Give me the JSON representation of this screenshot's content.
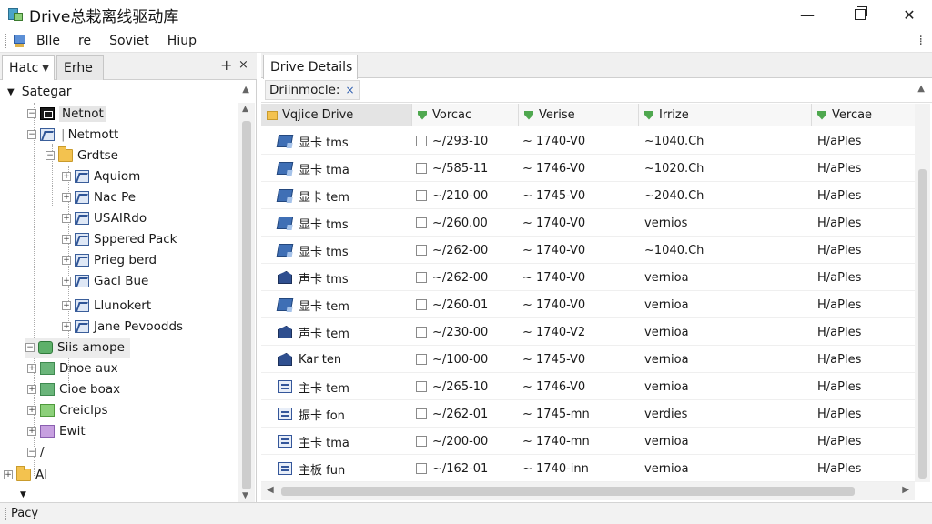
{
  "window": {
    "title": "Drive总栽离线驱动库",
    "min_glyph": "—",
    "close_glyph": "✕"
  },
  "menu": {
    "items": [
      "Blle",
      "re",
      "Soviet",
      "Hiup"
    ],
    "right_glyph": "⁞"
  },
  "left_panel": {
    "tabs": [
      {
        "label": "Hatc",
        "active": true
      },
      {
        "label": "Erhe",
        "active": false
      }
    ],
    "add_glyph": "+",
    "close_glyph": "×",
    "header": "Sategar",
    "tree": [
      {
        "label": "Netnot",
        "icon": "network-drive-icon",
        "highlight": true
      },
      {
        "label": "Netmott",
        "icon": "drive-icon",
        "highlight": false
      },
      {
        "label": "Grdtse",
        "icon": "folder-icon",
        "highlight": false
      },
      {
        "label": "Aquiom",
        "icon": "drive-icon",
        "highlight": false
      },
      {
        "label": "Nac Pe",
        "icon": "drive-icon",
        "highlight": false
      },
      {
        "label": "USAIRdo",
        "icon": "drive-icon",
        "highlight": false
      },
      {
        "label": "Sppered Pack",
        "icon": "drive-icon",
        "highlight": false
      },
      {
        "label": "Prieg berd",
        "icon": "drive-icon",
        "highlight": false
      },
      {
        "label": "Gacl Bue",
        "icon": "drive-icon",
        "highlight": false
      },
      {
        "label": "Llunokert",
        "icon": "drive-icon",
        "highlight": false
      },
      {
        "label": "Jane Pevoodds",
        "icon": "drive-icon",
        "highlight": false
      },
      {
        "label": "Siis amope",
        "icon": "globe-icon",
        "highlight": true
      },
      {
        "label": "Dnoe aux",
        "icon": "green-folder-icon",
        "highlight": false
      },
      {
        "label": "Cioe boax",
        "icon": "green-folder-icon",
        "highlight": false
      },
      {
        "label": "Creiclps",
        "icon": "lime-folder-icon",
        "highlight": false
      },
      {
        "label": "Ewit",
        "icon": "purple-folder-icon",
        "highlight": false
      },
      {
        "label": "/",
        "icon": "",
        "highlight": false
      },
      {
        "label": "AI",
        "icon": "folder-icon",
        "highlight": false
      }
    ]
  },
  "right_panel": {
    "tab": "Drive Details",
    "filter_chip": "Driinmocle:",
    "filter_close": "×",
    "columns": [
      "Vqjice Drive",
      "Vorcac",
      "Verise",
      "Irrize",
      "Vercae"
    ],
    "rows": [
      {
        "name": "显卡 tms",
        "icon": "db",
        "c1": "~/293-10",
        "c2": "~ 1740-V0",
        "c3": "~1040.Ch",
        "c4": "H/aPles"
      },
      {
        "name": "显卡 tma",
        "icon": "db",
        "c1": "~/585-11",
        "c2": "~ 1746-V0",
        "c3": "~1020.Ch",
        "c4": "H/aPles"
      },
      {
        "name": "显卡 tem",
        "icon": "db",
        "c1": "~/210-00",
        "c2": "~ 1745-V0",
        "c3": "~2040.Ch",
        "c4": "H/aPles"
      },
      {
        "name": "显卡 tms",
        "icon": "db",
        "c1": "~/260.00",
        "c2": "~ 1740-V0",
        "c3": "vernios",
        "c4": "H/aPles"
      },
      {
        "name": "显卡 tms",
        "icon": "db",
        "c1": "~/262-00",
        "c2": "~ 1740-V0",
        "c3": "~1040.Ch",
        "c4": "H/aPles"
      },
      {
        "name": "声卡 tms",
        "icon": "pen",
        "c1": "~/262-00",
        "c2": "~ 1740-V0",
        "c3": "vernioa",
        "c4": "H/aPles"
      },
      {
        "name": "显卡 tem",
        "icon": "db",
        "c1": "~/260-01",
        "c2": "~ 1740-V0",
        "c3": "vernioa",
        "c4": "H/aPles"
      },
      {
        "name": "声卡 tem",
        "icon": "pen",
        "c1": "~/230-00",
        "c2": "~ 1740-V2",
        "c3": "vernioa",
        "c4": "H/aPles"
      },
      {
        "name": "Kar ten",
        "icon": "pen",
        "c1": "~/100-00",
        "c2": "~ 1745-V0",
        "c3": "vernioa",
        "c4": "H/aPles"
      },
      {
        "name": "主卡 tem",
        "icon": "doc",
        "c1": "~/265-10",
        "c2": "~ 1746-V0",
        "c3": "vernioa",
        "c4": "H/aPles"
      },
      {
        "name": "振卡 fon",
        "icon": "doc",
        "c1": "~/262-01",
        "c2": "~ 1745-mn",
        "c3": "verdies",
        "c4": "H/aPles"
      },
      {
        "name": "主卡 tma",
        "icon": "doc",
        "c1": "~/200-00",
        "c2": "~ 1740-mn",
        "c3": "vernioa",
        "c4": "H/aPles"
      },
      {
        "name": "主板 fun",
        "icon": "doc",
        "c1": "~/162-01",
        "c2": "~ 1740-inn",
        "c3": "vernioa",
        "c4": "H/aPles"
      }
    ]
  },
  "status": {
    "text": "Pacy"
  }
}
